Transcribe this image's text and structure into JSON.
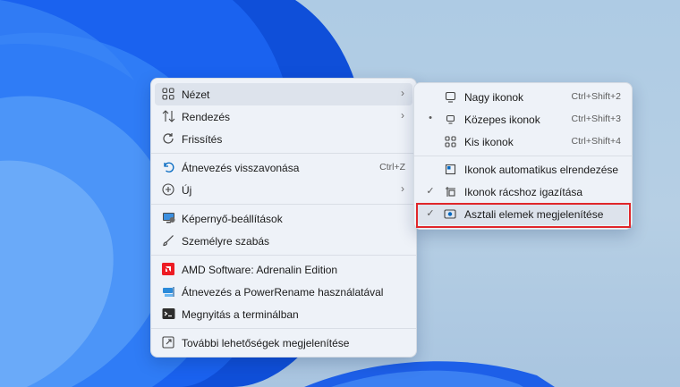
{
  "main_menu": {
    "items": [
      {
        "label": "Nézet",
        "icon": "view-grid-icon",
        "submenu": true
      },
      {
        "label": "Rendezés",
        "icon": "sort-arrows-icon",
        "submenu": true
      },
      {
        "label": "Frissítés",
        "icon": "refresh-icon"
      },
      {
        "label": "Átnevezés visszavonása",
        "icon": "undo-icon",
        "shortcut": "Ctrl+Z"
      },
      {
        "label": "Új",
        "icon": "new-plus-icon",
        "submenu": true
      },
      {
        "label": "Képernyő-beállítások",
        "icon": "display-settings-icon"
      },
      {
        "label": "Személyre szabás",
        "icon": "brush-icon"
      },
      {
        "label": "AMD Software: Adrenalin Edition",
        "icon": "amd-logo-icon"
      },
      {
        "label": "Átnevezés a PowerRename használatával",
        "icon": "powerrename-icon"
      },
      {
        "label": "Megnyitás a terminálban",
        "icon": "terminal-icon"
      },
      {
        "label": "További lehetőségek megjelenítése",
        "icon": "more-options-icon"
      }
    ]
  },
  "sub_menu": {
    "items": [
      {
        "label": "Nagy ikonok",
        "shortcut": "Ctrl+Shift+2",
        "icon": "monitor-large-icon",
        "mark": ""
      },
      {
        "label": "Közepes ikonok",
        "shortcut": "Ctrl+Shift+3",
        "icon": "monitor-medium-icon",
        "mark": "•"
      },
      {
        "label": "Kis ikonok",
        "shortcut": "Ctrl+Shift+4",
        "icon": "small-grid-icon",
        "mark": ""
      },
      {
        "label": "Ikonok automatikus elrendezése",
        "icon": "auto-arrange-icon",
        "mark": ""
      },
      {
        "label": "Ikonok rácshoz igazítása",
        "icon": "align-grid-icon",
        "mark": "✓"
      },
      {
        "label": "Asztali elemek megjelenítése",
        "icon": "show-desktop-icon",
        "mark": "✓"
      }
    ]
  },
  "colors": {
    "highlight_box": "#e0262a",
    "accent": "#0067c0",
    "amd_red": "#ed1c24"
  }
}
